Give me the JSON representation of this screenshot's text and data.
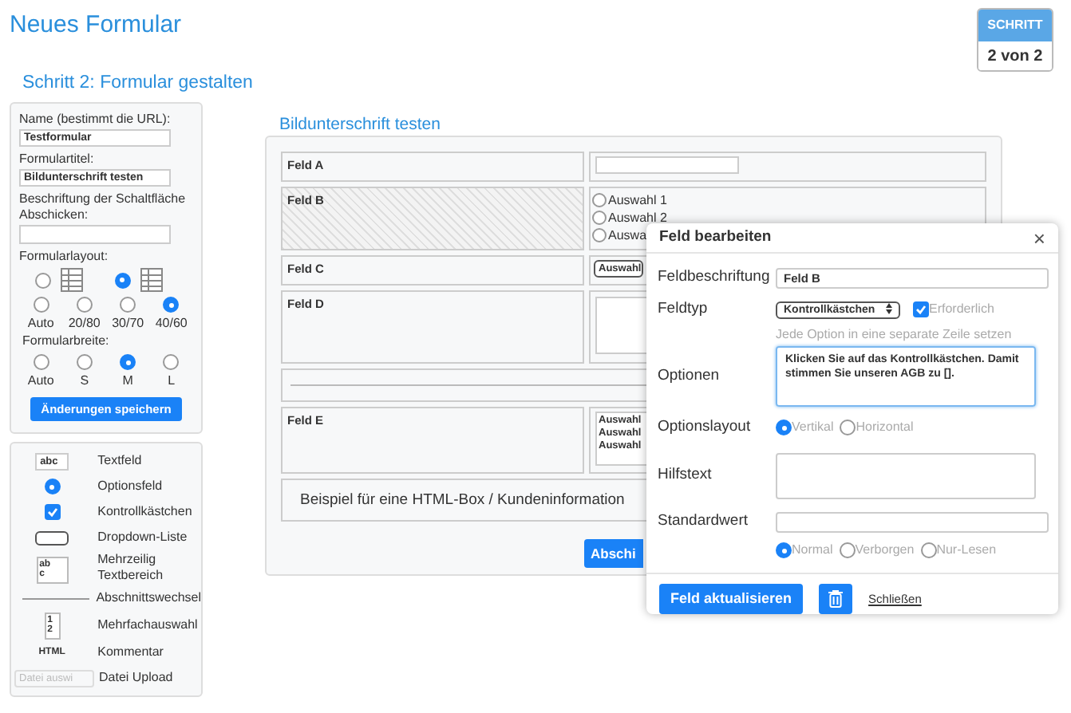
{
  "title": "Neues Formular",
  "step": {
    "label": "SCHRITT",
    "value": "2 von 2"
  },
  "subtitle": "Schritt 2: Formular gestalten",
  "settings": {
    "name_label": "Name (bestimmt die URL):",
    "name_value": "Testformular",
    "title_label": "Formulartitel:",
    "title_value": "Bildunterschrift testen",
    "submit_label": "Beschriftung der Schaltfläche Abschicken:",
    "layout_label": "Formularlayout:",
    "layout_styles": [
      {
        "selected": false
      },
      {
        "selected": true
      }
    ],
    "layouts": [
      {
        "label": "Auto",
        "selected": false
      },
      {
        "label": "20/80",
        "selected": false
      },
      {
        "label": "30/70",
        "selected": false
      },
      {
        "label": "40/60",
        "selected": true
      }
    ],
    "width_label": "Formularbreite:",
    "widths": [
      {
        "label": "Auto",
        "selected": false
      },
      {
        "label": "S",
        "selected": false
      },
      {
        "label": "M",
        "selected": true
      },
      {
        "label": "L",
        "selected": false
      }
    ],
    "save_button": "Änderungen speichern"
  },
  "palette": [
    {
      "kind": "textfield",
      "label": "Textfeld",
      "sample": "abc"
    },
    {
      "kind": "radio",
      "label": "Optionsfeld",
      "selected": true
    },
    {
      "kind": "checkbox",
      "label": "Kontrollkästchen",
      "checked": true
    },
    {
      "kind": "dropdown",
      "label": "Dropdown-Liste"
    },
    {
      "kind": "textarea",
      "label": "Mehrzeilig Textbereich",
      "sample": [
        "ab",
        "c"
      ]
    },
    {
      "kind": "section",
      "label": "Abschnittswechsel"
    },
    {
      "kind": "multiselect",
      "label": "Mehrfachauswahl",
      "sample": [
        "1",
        "2"
      ]
    },
    {
      "kind": "html",
      "label": "Kommentar",
      "sample": "HTML"
    },
    {
      "kind": "upload",
      "label": "Datei Upload",
      "sample": "Datei auswi"
    }
  ],
  "preview": {
    "title": "Bildunterschrift testen",
    "rows": [
      {
        "kind": "text",
        "label": "Feld A",
        "selected": false
      },
      {
        "kind": "radio",
        "label": "Feld B",
        "selected": true,
        "options": [
          {
            "label": "Auswahl 1",
            "selected": false
          },
          {
            "label": "Auswahl 2",
            "selected": false
          },
          {
            "label": "Auswa",
            "selected": false
          }
        ]
      },
      {
        "kind": "select",
        "label": "Feld C",
        "selected": false,
        "value": "Auswahl"
      },
      {
        "kind": "textarea",
        "label": "Feld D",
        "selected": false
      },
      {
        "kind": "section",
        "selected": false
      },
      {
        "kind": "list",
        "label": "Feld E",
        "selected": false,
        "options": [
          "Auswahl",
          "Auswahl",
          "Auswahl"
        ]
      },
      {
        "kind": "html",
        "text": "Beispiel für eine HTML-Box / Kundeninformation",
        "selected": false
      }
    ],
    "submit_button": "Abschi"
  },
  "dialog": {
    "title": "Feld bearbeiten",
    "close": "×",
    "label_label": "Feldbeschriftung",
    "label_value": "Feld B",
    "type_label": "Feldtyp",
    "type_value": "Kontrollkästchen",
    "required": {
      "label": "Erforderlich",
      "checked": true
    },
    "options_hint": "Jede Option in eine separate Zeile setzen",
    "options_label": "Optionen",
    "options_value": "Klicken Sie auf das Kontrollkästchen. Damit stimmen Sie unseren AGB zu [].",
    "layout_label": "Optionslayout",
    "layouts": [
      {
        "label": "Vertikal",
        "selected": true
      },
      {
        "label": "Horizontal",
        "selected": false
      }
    ],
    "help_label": "Hilfstext",
    "default_label": "Standardwert",
    "visibility": [
      {
        "label": "Normal",
        "selected": true
      },
      {
        "label": "Verborgen",
        "selected": false
      },
      {
        "label": "Nur-Lesen",
        "selected": false
      }
    ],
    "update_button": "Feld aktualisieren",
    "close_link": "Schließen"
  }
}
